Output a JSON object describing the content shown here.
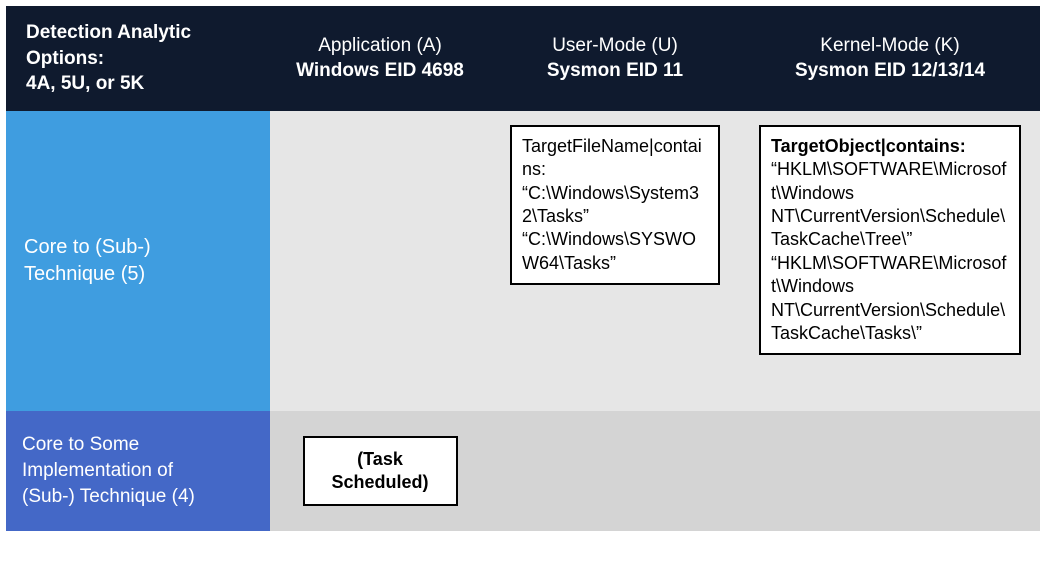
{
  "header": {
    "options_title": "Detection Analytic Options:",
    "options_values": "4A, 5U, or 5K",
    "col_app_top": "Application (A)",
    "col_app_bold": "Windows EID 4698",
    "col_user_top": "User-Mode (U)",
    "col_user_bold": "Sysmon EID 11",
    "col_kernel_top": "Kernel-Mode (K)",
    "col_kernel_bold": "Sysmon EID 12/13/14"
  },
  "rows": {
    "r5_label_l1": "Core to (Sub-)",
    "r5_label_l2": "Technique (5)",
    "r4_label_l1": "Core to Some",
    "r4_label_l2": "Implementation of",
    "r4_label_l3": "(Sub-) Technique (4)"
  },
  "boxes": {
    "user_mode": "TargetFileName|contains: “C:\\Windows\\System32\\Tasks” “C:\\Windows\\SYSWOW64\\Tasks”",
    "kernel_bold": "TargetObject|contains:",
    "kernel_rest": "“HKLM\\SOFTWARE\\Microsoft\\Windows NT\\CurrentVersion\\Schedule\\TaskCache\\Tree\\” “HKLM\\SOFTWARE\\Microsoft\\Windows NT\\CurrentVersion\\Schedule\\TaskCache\\Tasks\\”",
    "app_r4": "(Task Scheduled)"
  }
}
